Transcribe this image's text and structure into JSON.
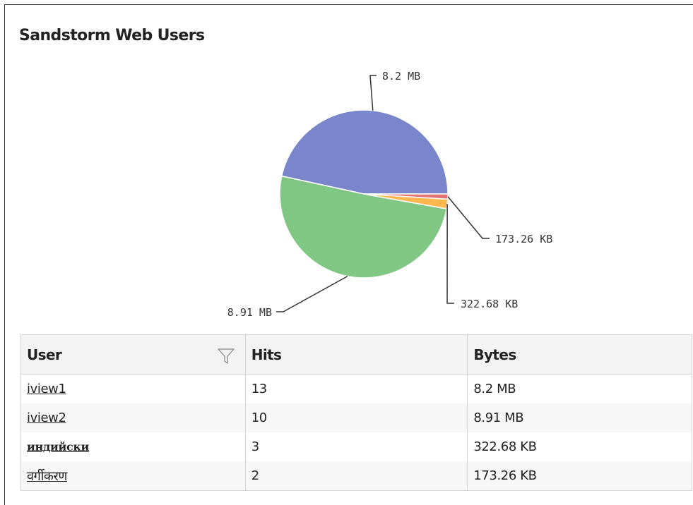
{
  "panel": {
    "title": "Sandstorm Web Users"
  },
  "chart_data": {
    "type": "pie",
    "title": "Sandstorm Web Users",
    "slices": [
      {
        "label": "8.2 MB",
        "user": "iview1",
        "value": 8.2,
        "unit": "MB",
        "color": "#7986cb"
      },
      {
        "label": "8.91 MB",
        "user": "iview2",
        "value": 8.91,
        "unit": "MB",
        "color": "#81c784"
      },
      {
        "label": "322.68 KB",
        "user": "индийски",
        "value": 0.32268,
        "unit": "MB",
        "color": "#ffb74d"
      },
      {
        "label": "173.26 KB",
        "user": "वर्गीकरण",
        "value": 0.17326,
        "unit": "MB",
        "color": "#e57373"
      }
    ]
  },
  "table": {
    "columns": [
      "User",
      "Hits",
      "Bytes"
    ],
    "rows": [
      {
        "user": "iview1",
        "hits": "13",
        "bytes": "8.2 MB"
      },
      {
        "user": "iview2",
        "hits": "10",
        "bytes": "8.91 MB"
      },
      {
        "user": "индийски",
        "hits": "3",
        "bytes": "322.68 KB"
      },
      {
        "user": "वर्गीकरण",
        "hits": "2",
        "bytes": "173.26 KB"
      }
    ]
  },
  "icons": {
    "filter": "filter-funnel-icon"
  }
}
